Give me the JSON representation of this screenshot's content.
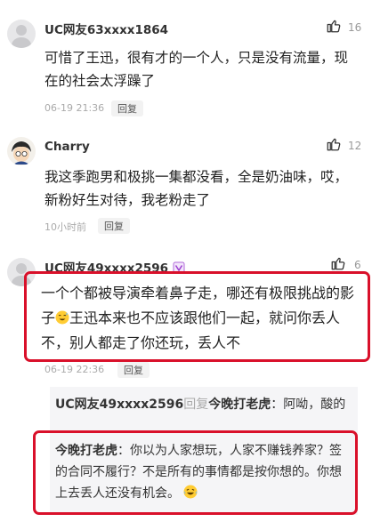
{
  "comments": [
    {
      "username": "UC网友63xxxx1864",
      "likes": "16",
      "text": "可惜了王迅，很有才的一个人，只是没有流量，现在的社会太浮躁了",
      "time": "06-19 21:36",
      "reply_label": "回复"
    },
    {
      "username": "Charry",
      "likes": "12",
      "text": "我这季跑男和极挑一集都没看，全是奶油味，哎，新粉好生对待，我老粉走了",
      "time": "10小时前",
      "reply_label": "回复"
    },
    {
      "username": "UC网友49xxxx2596",
      "likes": "6",
      "text_part1": "一个个都被导演牵着鼻子走，哪还有极限挑战的影子",
      "text_part2": "王迅本来也不应该跟他们一起，就问你丢人不，别人都走了你还玩，丢人不",
      "time": "06-19 22:36",
      "reply_label": "回复",
      "replies": [
        {
          "from": "UC网友49xxxx2596",
          "action": "回复",
          "to": "今晚打老虎",
          "text": "：阿呦，酸的"
        },
        {
          "from": "今晚打老虎",
          "text": "：你以为人家想玩，人家不赚钱养家？签的合同不履行？不是所有的事情都是按你想的。你想上去丢人还没有机会。"
        }
      ]
    }
  ],
  "colors": {
    "highlight": "#d9102a",
    "muted": "#999999",
    "reply_action": "#aaaaaa"
  },
  "icons": [
    "thumbs-up-icon",
    "avatar-icon",
    "vip-badge-icon",
    "sweat-smile-emoji",
    "laughing-tears-emoji"
  ]
}
